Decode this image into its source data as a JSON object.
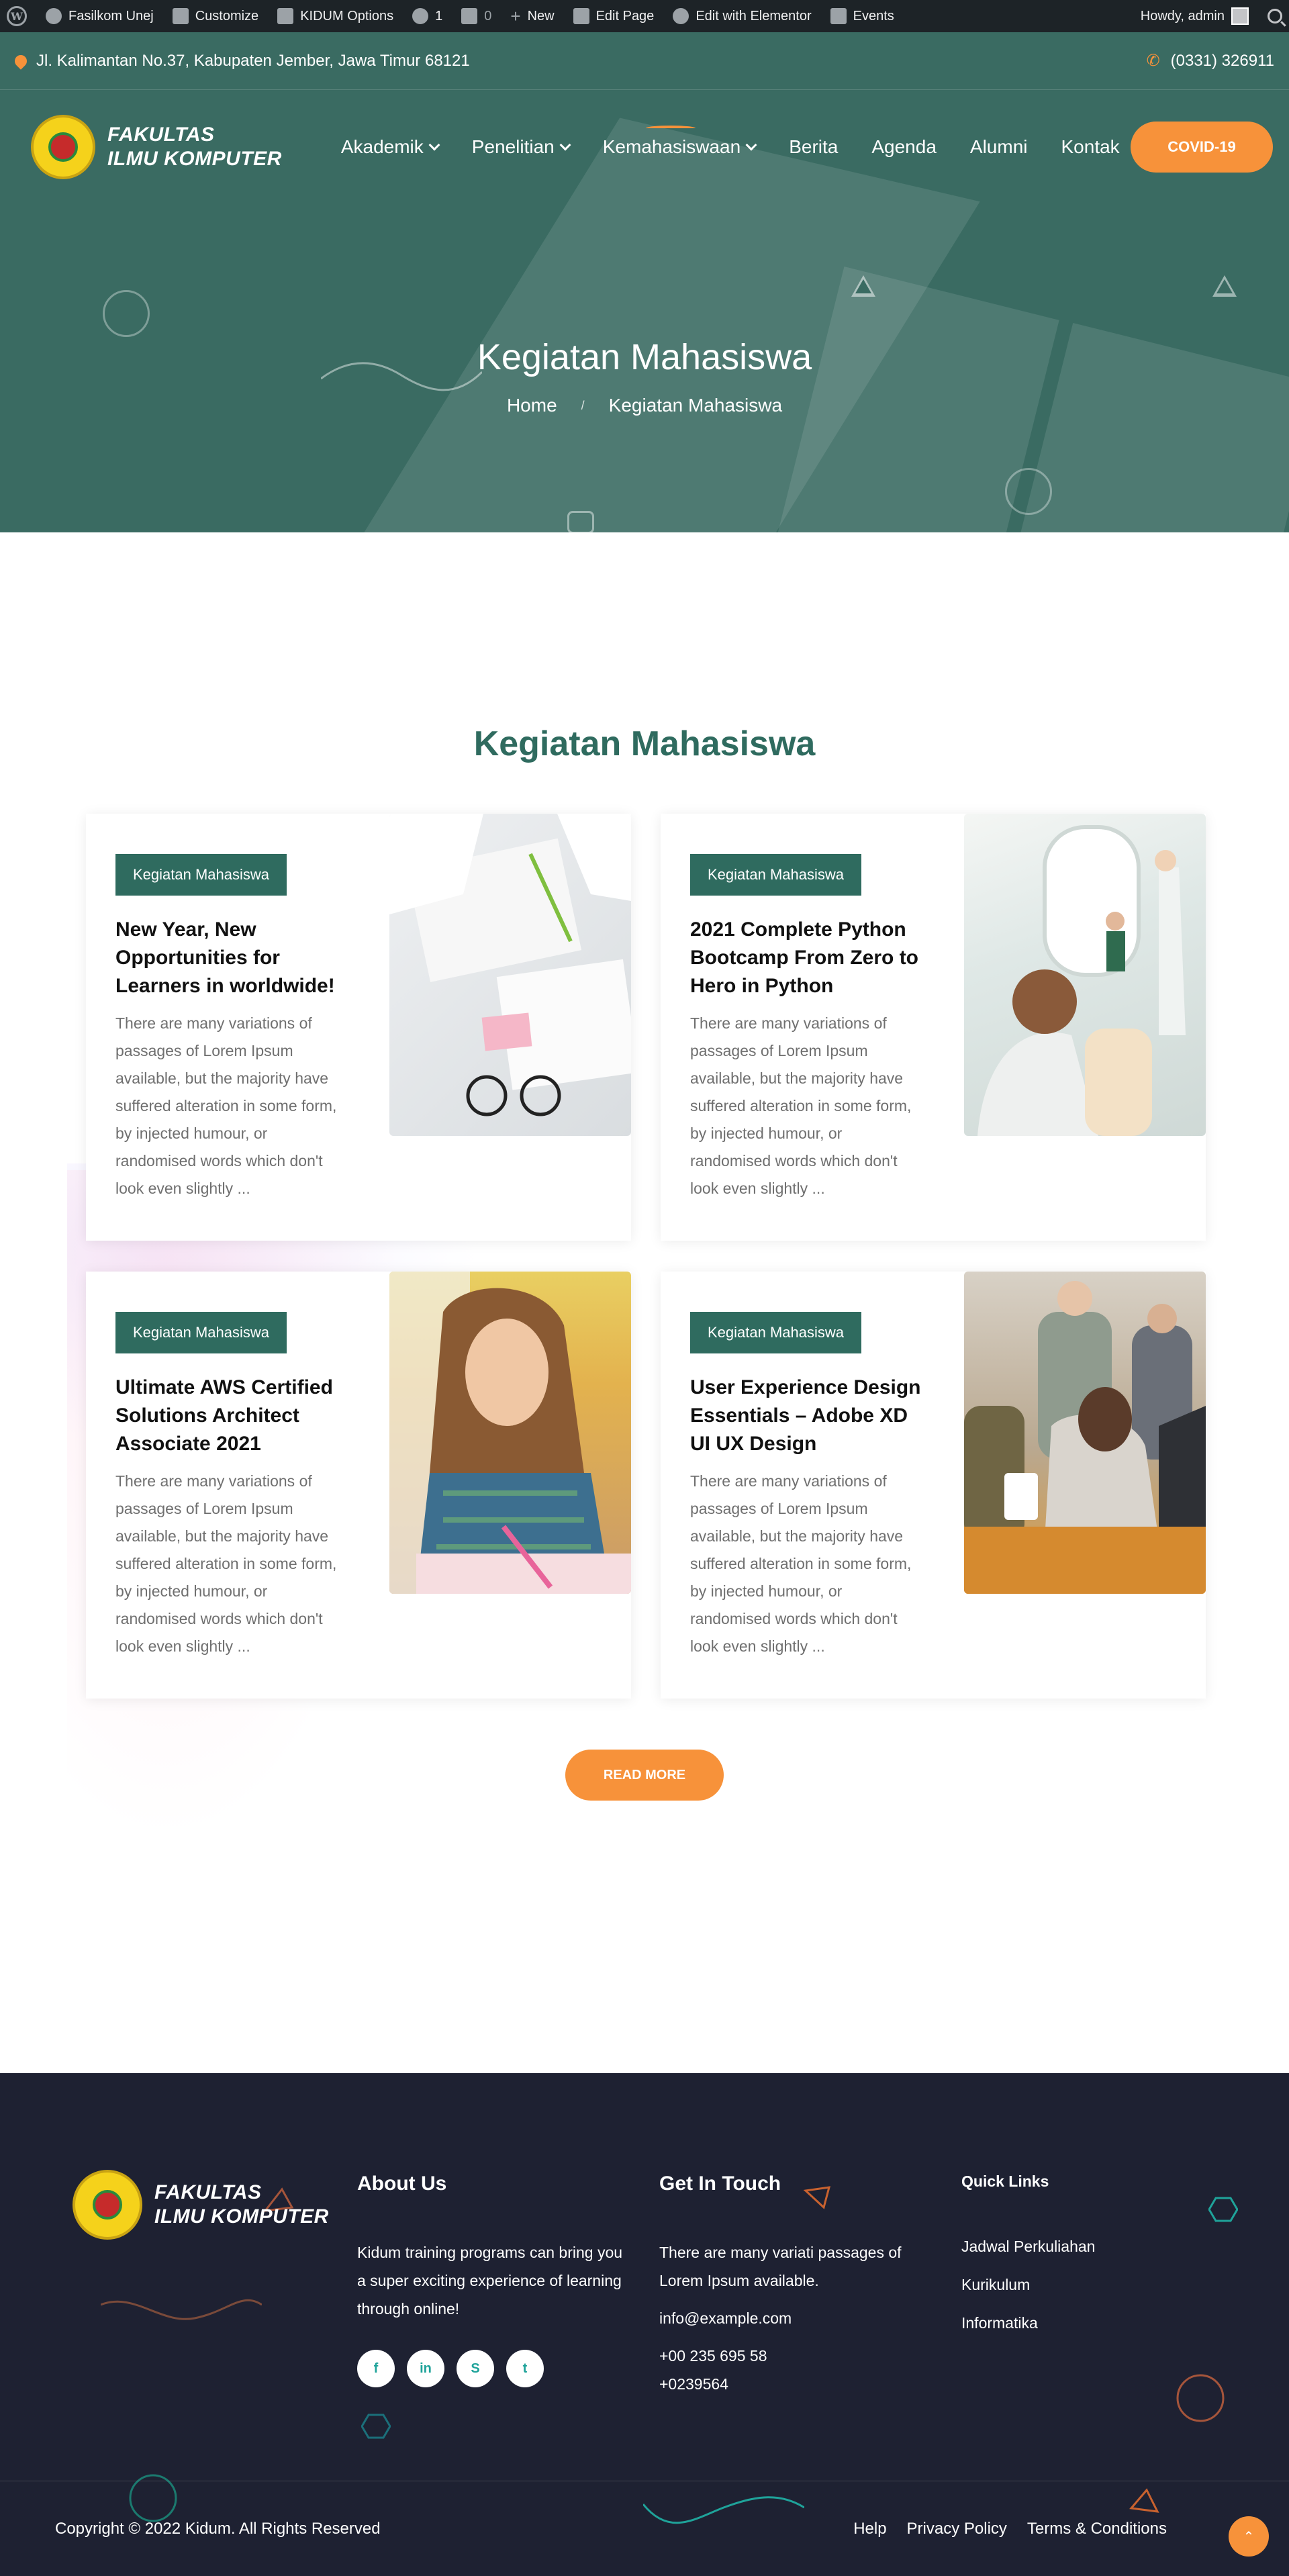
{
  "adminbar": {
    "site": "Fasilkom Unej",
    "customize": "Customize",
    "options": "KIDUM Options",
    "updates": "1",
    "comments": "0",
    "new": "New",
    "edit_page": "Edit Page",
    "elementor": "Edit with Elementor",
    "events": "Events",
    "howdy": "Howdy, admin"
  },
  "topbar": {
    "address": "Jl. Kalimantan No.37, Kabupaten Jember, Jawa Timur 68121",
    "phone": "(0331) 326911"
  },
  "logo": {
    "line1": "FAKULTAS",
    "line2": "ILMU KOMPUTER"
  },
  "nav": {
    "items": [
      "Akademik",
      "Penelitian",
      "Kemahasiswaan",
      "Berita",
      "Agenda",
      "Alumni",
      "Kontak"
    ],
    "cta": "COVID-19"
  },
  "hero": {
    "title": "Kegiatan Mahasiswa",
    "breadcrumb_home": "Home",
    "breadcrumb_sep": "/",
    "breadcrumb_current": "Kegiatan Mahasiswa"
  },
  "section": {
    "title": "Kegiatan Mahasiswa"
  },
  "cards": [
    {
      "category": "Kegiatan Mahasiswa",
      "title": "New Year, New Opportunities for Learners in worldwide!",
      "excerpt": "There are many variations of passages of Lorem Ipsum available, but the majority have suffered alteration in some form, by injected humour, or randomised words which don't look even slightly ..."
    },
    {
      "category": "Kegiatan Mahasiswa",
      "title": "2021 Complete Python Bootcamp From Zero to Hero in Python",
      "excerpt": "There are many variations of passages of Lorem Ipsum available, but the majority have suffered alteration in some form, by injected humour, or randomised words which don't look even slightly ..."
    },
    {
      "category": "Kegiatan Mahasiswa",
      "title": "Ultimate AWS Certified Solutions Architect Associate 2021",
      "excerpt": "There are many variations of passages of Lorem Ipsum available, but the majority have suffered alteration in some form, by injected humour, or randomised words which don't look even slightly ..."
    },
    {
      "category": "Kegiatan Mahasiswa",
      "title": "User Experience Design Essentials – Adobe XD UI UX Design",
      "excerpt": "There are many variations of passages of Lorem Ipsum available, but the majority have suffered alteration in some form, by injected humour, or randomised words which don't look even slightly ..."
    }
  ],
  "read_more": "READ MORE",
  "footer": {
    "about_head": "About Us",
    "about_text": "Kidum training programs can bring you a super exciting experience of learning through online!",
    "social": [
      "f",
      "in",
      "S",
      "t"
    ],
    "contact_head": "Get In Touch",
    "contact_text": "There are many variati passages of Lorem Ipsum available.",
    "email": "info@example.com",
    "phone1": "+00 235 695 58",
    "phone2": "+0239564",
    "links_head": "Quick Links",
    "links": [
      "Jadwal Perkuliahan",
      "Kurikulum",
      "Informatika"
    ],
    "copyright": "Copyright © 2022 Kidum. All Rights Reserved",
    "bottom_links": [
      "Help",
      "Privacy Policy",
      "Terms & Conditions"
    ]
  },
  "colors": {
    "primary": "#3a6b62",
    "accent": "#f7923a",
    "footer_bg": "#1e2132",
    "adminbar_bg": "#1d2327"
  }
}
